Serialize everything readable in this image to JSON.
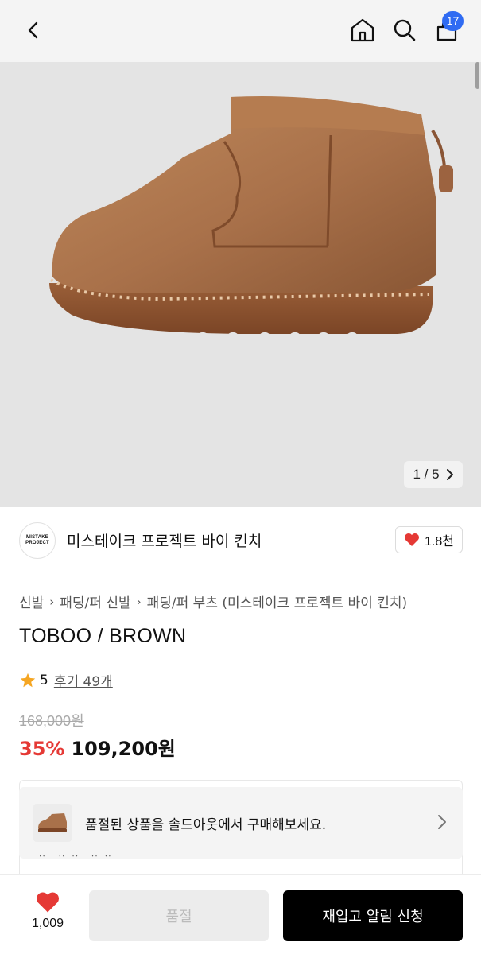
{
  "header": {
    "back_icon": "chevron-left-icon",
    "home_icon": "home-icon",
    "search_icon": "search-icon",
    "cart_icon": "cart-icon",
    "cart_count": "17",
    "badge_color": "#2f6bf2"
  },
  "gallery": {
    "counter": "1 / 5",
    "next_icon": "chevron-right-icon"
  },
  "brand": {
    "logo_line1": "MISTAKE",
    "logo_line2": "PROJECT",
    "name": "미스테이크 프로젝트 바이 킨치",
    "like_count": "1.8천",
    "heart_color": "#e53935"
  },
  "breadcrumb": [
    "신발",
    "패딩/퍼 신발",
    "패딩/퍼 부츠 (미스테이크 프로젝트 바이 킨치)"
  ],
  "product": {
    "title": "TOBOO / BROWN",
    "rating": "5",
    "reviews": "후기 49개",
    "original_price": "168,000원",
    "discount": "35%",
    "sale_price": "109,200원",
    "discount_color": "#e53935"
  },
  "soldout_banner": {
    "text": "품절된 상품을 솔드아웃에서 구매해보세요.",
    "partial_row": "ᆢ ᆢᆢ ᆢᆢ"
  },
  "bottom_bar": {
    "wish_count": "1,009",
    "soldout_label": "품절",
    "restock_label": "재입고 알림 신청"
  }
}
